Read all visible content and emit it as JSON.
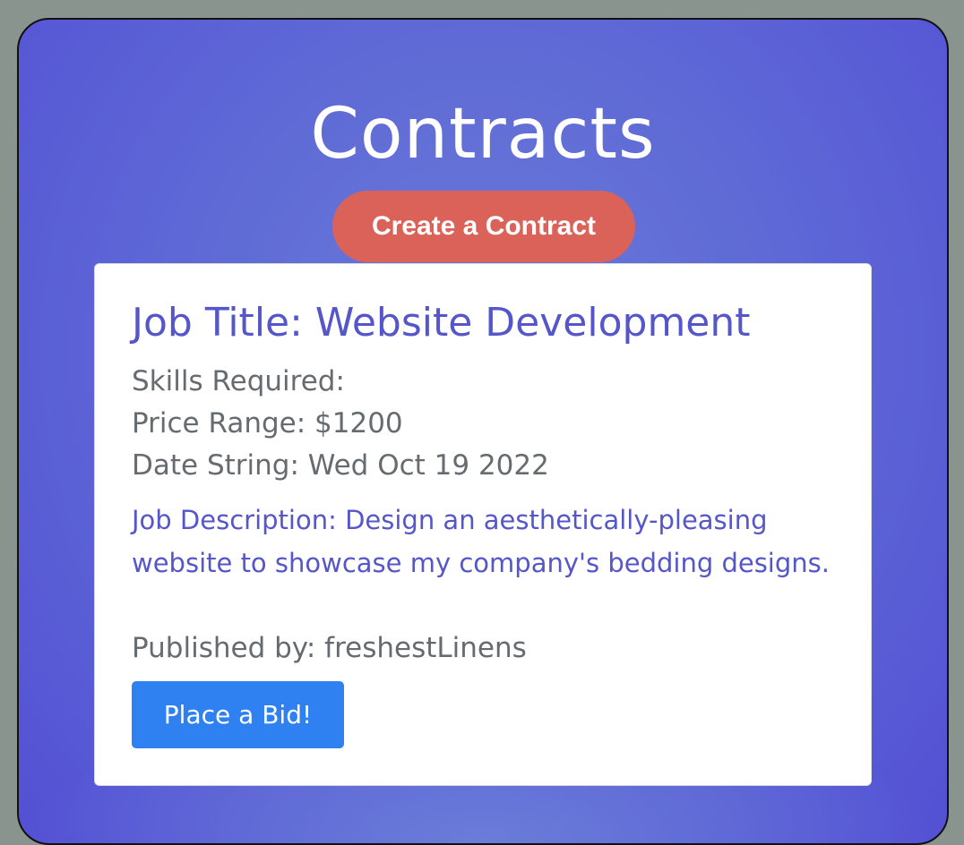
{
  "page": {
    "title": "Contracts",
    "create_button_label": "Create a Contract"
  },
  "contract": {
    "job_title": "Job Title: Website Development",
    "skills": "Skills Required:",
    "price": "Price Range: $1200",
    "date": "Date String: Wed Oct 19 2022",
    "description": "Job Description: Design an aesthetically-pleasing website to showcase my company's bedding designs.",
    "published_by": "Published by: freshestLinens",
    "bid_button_label": "Place a Bid!"
  },
  "colors": {
    "background": "#8a948f",
    "panel_gradient_start": "#6a7bd8",
    "panel_gradient_end": "#5350d4",
    "create_button": "#db6259",
    "card_accent_text": "#5556c9",
    "bid_button": "#2f80f0"
  }
}
